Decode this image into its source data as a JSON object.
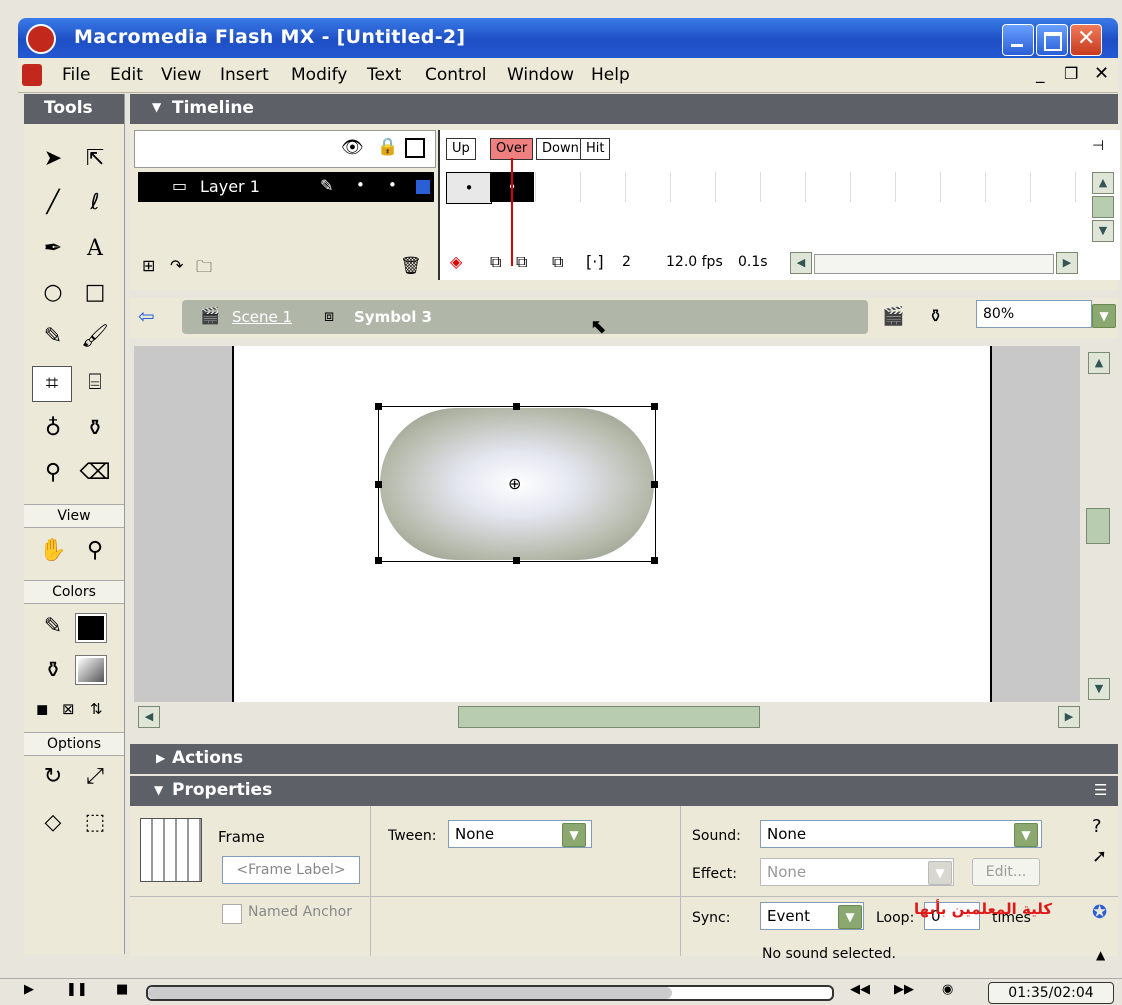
{
  "window": {
    "title": "Macromedia Flash MX - [Untitled-2]"
  },
  "menu": [
    "File",
    "Edit",
    "View",
    "Insert",
    "Modify",
    "Text",
    "Control",
    "Window",
    "Help"
  ],
  "tools": {
    "header": "Tools",
    "view_label": "View",
    "colors_label": "Colors",
    "options_label": "Options"
  },
  "timeline": {
    "header": "Timeline",
    "layer_name": "Layer 1",
    "frame_labels": [
      "Up",
      "Over",
      "Down",
      "Hit"
    ],
    "current_frame": "2",
    "fps": "12.0 fps",
    "time": "0.1s"
  },
  "stage": {
    "scene": "Scene 1",
    "symbol": "Symbol 3",
    "zoom": "80%"
  },
  "actions": {
    "header": "Actions"
  },
  "properties": {
    "header": "Properties",
    "frame_title": "Frame",
    "frame_label_placeholder": "<Frame Label>",
    "named_anchor": "Named Anchor",
    "tween_label": "Tween:",
    "tween_value": "None",
    "sound_label": "Sound:",
    "sound_value": "None",
    "effect_label": "Effect:",
    "effect_value": "None",
    "edit_button": "Edit...",
    "sync_label": "Sync:",
    "sync_value": "Event",
    "loop_label": "Loop:",
    "loop_value": "0",
    "times_label": "times",
    "status": "No sound selected.",
    "watermark": "كلية المعلمين بأبها"
  },
  "player": {
    "time": "01:35/02:04"
  },
  "colors": {
    "titlebar": "#2458d2",
    "panel_header": "#5e6068",
    "over_frame": "#f08080",
    "stage_bg": "#ffffff"
  }
}
